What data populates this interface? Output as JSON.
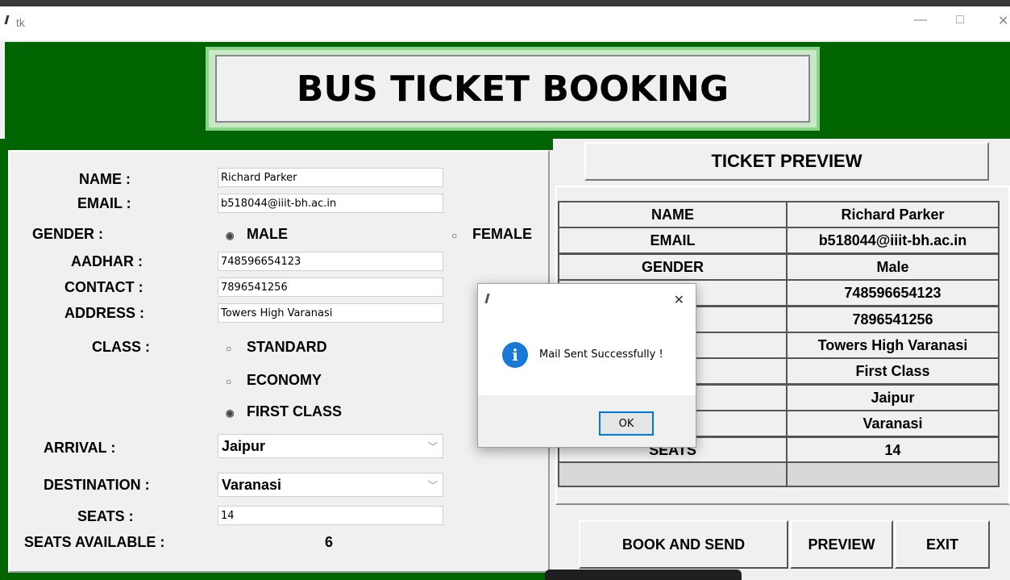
{
  "window": {
    "title": "tk",
    "minimize": "—",
    "maximize": "□",
    "close": "✕"
  },
  "banner": {
    "title": "BUS TICKET BOOKING"
  },
  "form": {
    "name_label": "NAME :",
    "name_value": "Richard Parker",
    "email_label": "EMAIL :",
    "email_value": "b518044@iiit-bh.ac.in",
    "gender_label": "GENDER :",
    "gender_male": "MALE",
    "gender_female": "FEMALE",
    "gender_selected": "MALE",
    "aadhar_label": "AADHAR :",
    "aadhar_value": "748596654123",
    "contact_label": "CONTACT :",
    "contact_value": "7896541256",
    "address_label": "ADDRESS :",
    "address_value": "Towers High Varanasi",
    "class_label": "CLASS :",
    "class_standard": "STANDARD",
    "class_economy": "ECONOMY",
    "class_first": "FIRST CLASS",
    "class_selected": "FIRST CLASS",
    "arrival_label": "ARRIVAL :",
    "arrival_value": "Jaipur",
    "destination_label": "DESTINATION :",
    "destination_value": "Varanasi",
    "seats_label": "SEATS :",
    "seats_value": "14",
    "seats_available_label": "SEATS AVAILABLE :",
    "seats_available_value": "6"
  },
  "preview": {
    "title": "TICKET PREVIEW",
    "rows": [
      {
        "key": "NAME",
        "value": "Richard Parker"
      },
      {
        "key": "EMAIL",
        "value": "b518044@iiit-bh.ac.in"
      },
      {
        "key": "GENDER",
        "value": "Male"
      },
      {
        "key": "R",
        "value": "748596654123"
      },
      {
        "key": "CT",
        "value": "7896541256"
      },
      {
        "key": "R",
        "value": "Towers High Varanasi"
      },
      {
        "key": "S",
        "value": "First Class"
      },
      {
        "key": "L",
        "value": "Jaipur"
      },
      {
        "key": "TION",
        "value": "Varanasi"
      },
      {
        "key": "SEATS",
        "value": "14"
      }
    ]
  },
  "buttons": {
    "book": "BOOK AND SEND",
    "preview": "PREVIEW",
    "exit": "EXIT"
  },
  "dialog": {
    "message": "Mail Sent Successfully !",
    "ok": "OK",
    "close": "✕",
    "icon": "info-icon"
  }
}
